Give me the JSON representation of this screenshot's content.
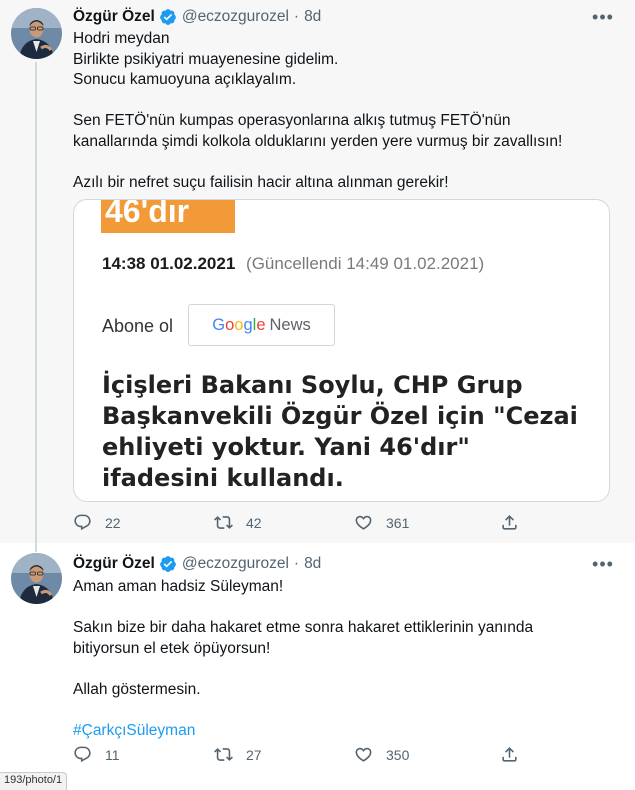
{
  "tweets": [
    {
      "author": {
        "name": "Özgür Özel",
        "handle": "@eczozgurozel",
        "age": "8d"
      },
      "text_lines": [
        "Hodri meydan",
        "Birlikte psikiyatri muayenesine gidelim.",
        "Sonucu kamuoyuna açıklayalım.",
        "",
        "Sen FETÖ'nün kumpas operasyonlarına alkış tutmuş FETÖ'nün",
        "kanallarında şimdi kolkola olduklarını yerden yere vurmuş bir zavallısın!",
        "",
        "Azılı bir nefret suçu failisin hacir altına alınman gerekir!"
      ],
      "card": {
        "badge_text": "46'dır",
        "timestamp": "14:38 01.02.2021",
        "updated": "(Güncellendi 14:49 01.02.2021)",
        "subscribe_label": "Abone ol",
        "google_news": {
          "g1": "G",
          "g2": "o",
          "g3": "o",
          "g4": "g",
          "g5": "l",
          "g6": "e",
          "news": "News"
        },
        "headline": "İçişleri Bakanı Soylu, CHP Grup Başkanvekili Özgür Özel için \"Cezai ehliyeti yoktur. Yani 46'dır\" ifadesini kullandı."
      },
      "stats": {
        "replies": "22",
        "retweets": "42",
        "likes": "361"
      }
    },
    {
      "author": {
        "name": "Özgür Özel",
        "handle": "@eczozgurozel",
        "age": "8d"
      },
      "text_lines": [
        "Aman aman hadsiz Süleyman!",
        "",
        "Sakın bize bir daha hakaret etme sonra hakaret ettiklerinin yanında",
        "bitiyorsun el etek öpüyorsun!",
        "",
        "Allah göstermesin.",
        ""
      ],
      "hashtag": "#ÇarkçıSüleyman",
      "stats": {
        "replies": "11",
        "retweets": "27",
        "likes": "350"
      }
    }
  ],
  "status_url": "193/photo/1",
  "colors": {
    "verified": "#1d9bf0",
    "hashtag": "#1d9bf0",
    "badge": "#f29a37",
    "muted": "#536471"
  },
  "icons": [
    "verified-badge-icon",
    "more-icon",
    "reply-icon",
    "retweet-icon",
    "like-icon",
    "share-icon"
  ]
}
